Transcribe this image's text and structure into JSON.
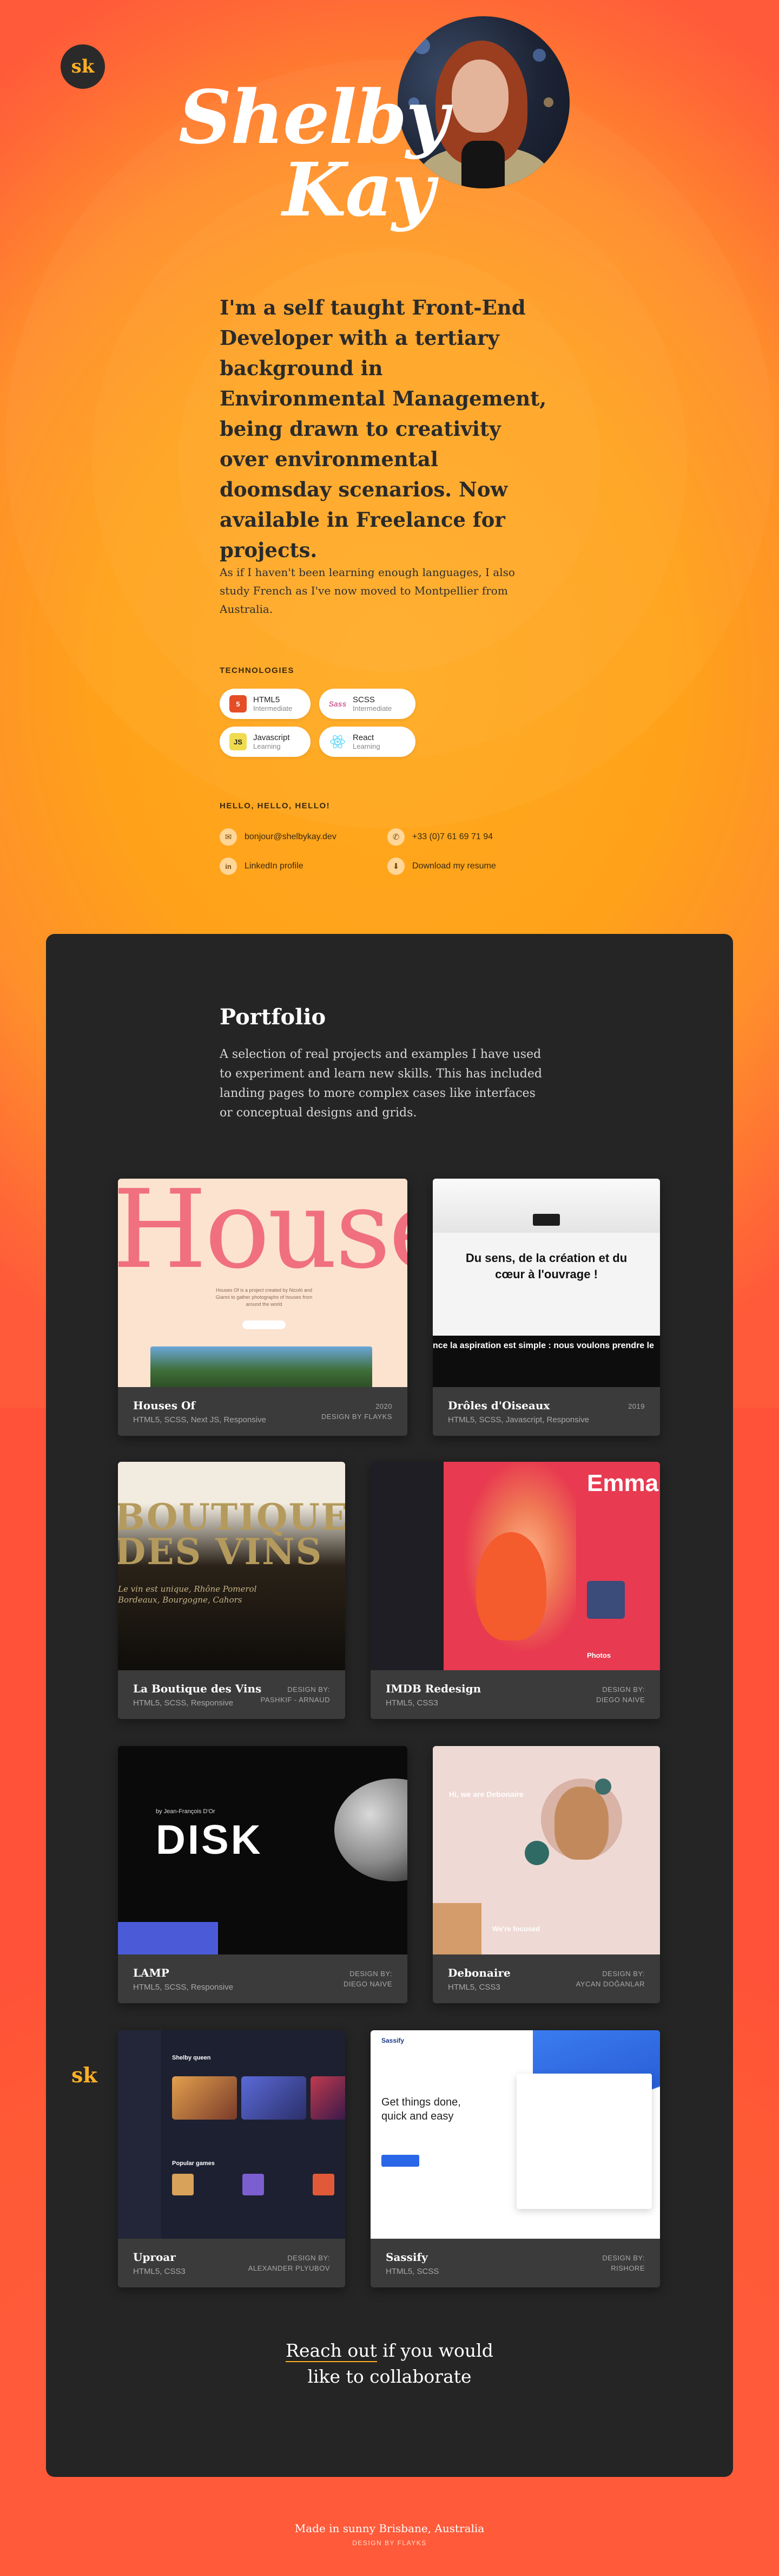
{
  "brand": {
    "logo_text": "sk"
  },
  "hero": {
    "name_line1": "Shelby",
    "name_line2": "Kay",
    "intro": "I'm a self taught Front-End Developer with a tertiary background in Environmental Management, being drawn to creativity over environmental doomsday scenarios. Now available in Freelance for projects.",
    "subintro": "As if I haven't been learning enough languages, I also study French as I've now moved to Montpellier from Australia."
  },
  "technologies": {
    "label": "TECHNOLOGIES",
    "items": [
      {
        "name": "HTML5",
        "level": "Intermediate",
        "icon": "html5-icon"
      },
      {
        "name": "SCSS",
        "level": "Intermediate",
        "icon": "sass-icon"
      },
      {
        "name": "Javascript",
        "level": "Learning",
        "icon": "javascript-icon"
      },
      {
        "name": "React",
        "level": "Learning",
        "icon": "react-icon"
      }
    ]
  },
  "contact": {
    "label": "HELLO, HELLO, HELLO!",
    "items": [
      {
        "text": "bonjour@shelbykay.dev",
        "icon": "email-icon"
      },
      {
        "text": "+33 (0)7 61 69 71 94",
        "icon": "phone-icon"
      },
      {
        "text": "LinkedIn profile",
        "icon": "linkedin-icon"
      },
      {
        "text": "Download my resume",
        "icon": "download-icon"
      }
    ]
  },
  "portfolio": {
    "title": "Portfolio",
    "description": "A selection of real projects and examples I have used to experiment and learn new skills. This has included landing pages to more complex cases like interfaces or conceptual designs and grids.",
    "projects": [
      {
        "title": "Houses Of",
        "tech": "HTML5, SCSS, Next JS, Responsive",
        "meta1": "2020",
        "meta2": "DESIGN BY FLAYKS",
        "thumb_text": "House",
        "thumb_caption": "Houses Of is a project created by Nicolò and Gianni to gather photographs of houses from around the world"
      },
      {
        "title": "Drôles d'Oiseaux",
        "tech": "HTML5, SCSS, Javascript, Responsive",
        "meta1": "2019",
        "meta2": "",
        "thumb_text": "Du sens, de la création et du cœur à l'ouvrage !",
        "thumb_caption": "nce la aspiration est simple : nous voulons prendre le"
      },
      {
        "title": "La Boutique des Vins",
        "tech": "HTML5, SCSS, Responsive",
        "meta1": "DESIGN BY:",
        "meta2": "PASHKIF - ARNAUD",
        "thumb_text": "BOUTIQUE DES VINS",
        "thumb_caption": "Le vin est unique, Rhône Pomerol Bordeaux, Bourgogne, Cahors"
      },
      {
        "title": "IMDB Redesign",
        "tech": "HTML5, CSS3",
        "meta1": "DESIGN BY:",
        "meta2": "DIEGO NAIVE",
        "thumb_text": "Emma",
        "thumb_caption": "Photos"
      },
      {
        "title": "LAMP",
        "tech": "HTML5, SCSS, Responsive",
        "meta1": "DESIGN BY:",
        "meta2": "DIEGO NAIVE",
        "thumb_text": "DISK",
        "thumb_caption": "by Jean-François D'Or"
      },
      {
        "title": "Debonaire",
        "tech": "HTML5, CSS3",
        "meta1": "DESIGN BY:",
        "meta2": "AYCAN DOĞANLAR",
        "thumb_text": "Hi, we are Debonaire",
        "thumb_caption": "We're focused"
      },
      {
        "title": "Uproar",
        "tech": "HTML5, CSS3",
        "meta1": "DESIGN BY:",
        "meta2": "ALEXANDER PLYUBOV",
        "thumb_text": "Shelby queen",
        "thumb_caption": "Popular games"
      },
      {
        "title": "Sassify",
        "tech": "HTML5, SCSS",
        "meta1": "DESIGN BY:",
        "meta2": "RISHORE",
        "thumb_text": "Get things done, quick and easy",
        "thumb_caption": "Sassify"
      }
    ]
  },
  "cta": {
    "line1": "Reach out",
    "line1_rest": " if you would",
    "line2": "like to collaborate"
  },
  "footer": {
    "line1": "Made in sunny Brisbane, Australia",
    "line2": "DESIGN BY FLAYKS"
  },
  "colors": {
    "accent": "#ffb024",
    "panel": "#252525",
    "card": "#3b3b3b",
    "orange": "#ffa21a"
  }
}
